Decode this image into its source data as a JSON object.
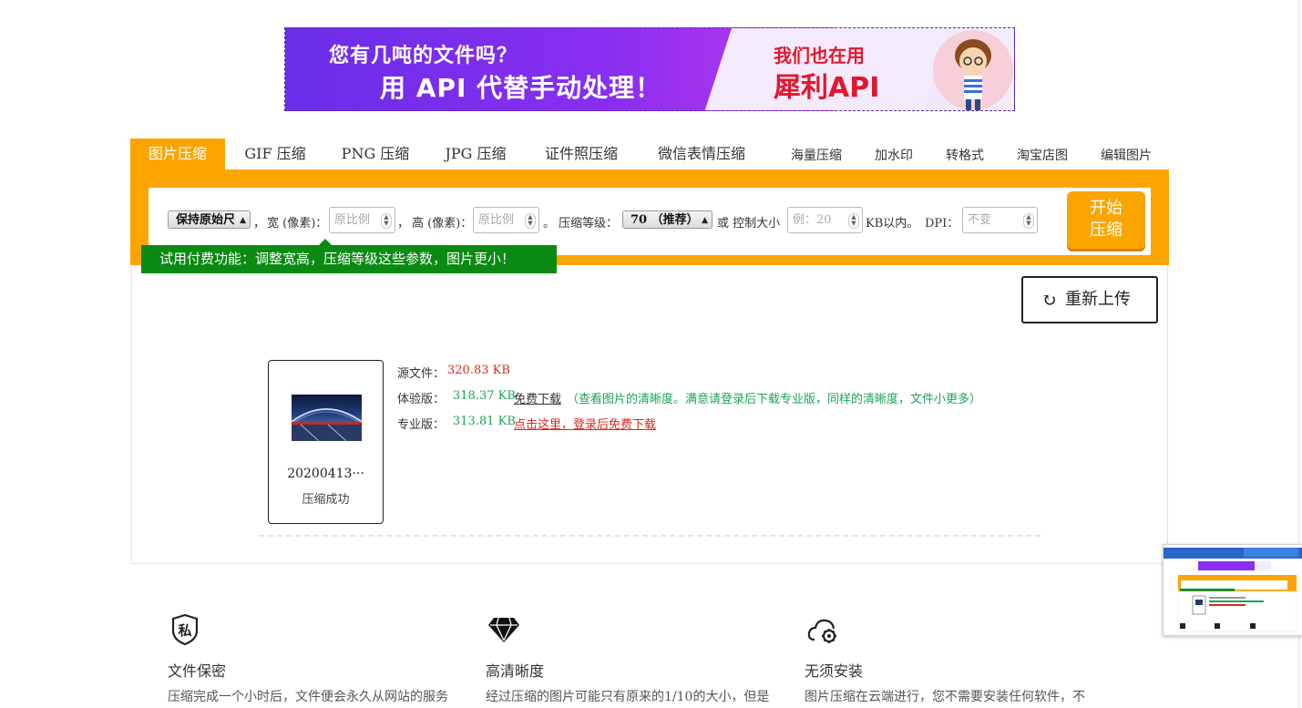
{
  "banner": {
    "line1": "您有几吨的文件吗？",
    "line2": "用 API 代替手动处理！",
    "right1": "我们也在用",
    "right2": "犀利API"
  },
  "tabs": [
    {
      "label": "图片压缩",
      "active": true
    },
    {
      "label": "GIF 压缩"
    },
    {
      "label": "PNG 压缩"
    },
    {
      "label": "JPG 压缩"
    },
    {
      "label": "证件照压缩"
    },
    {
      "label": "微信表情压缩"
    },
    {
      "label": "海量压缩"
    },
    {
      "label": "加水印"
    },
    {
      "label": "转格式"
    },
    {
      "label": "淘宝店图"
    },
    {
      "label": "编辑图片"
    }
  ],
  "options": {
    "size_mode": "保持原始尺寸",
    "width_label": "宽 (像素)：",
    "width_placeholder": "原比例",
    "height_label": "高 (像素)：",
    "height_placeholder": "原比例",
    "level_label": "压缩等级：",
    "level_value": "70 （推荐）",
    "or_label": "或 控制大小",
    "size_placeholder": "例：20",
    "kb_label": "KB以内。",
    "dpi_label": "DPI：",
    "dpi_placeholder": "不变",
    "start_label_1": "开始",
    "start_label_2": "压缩"
  },
  "promo": "试用付费功能：调整宽高，压缩等级这些参数，图片更小！",
  "reupload_label": "重新上传",
  "result": {
    "filename": "20200413···",
    "status": "压缩成功",
    "source_label": "源文件：",
    "source_size": "320.83 KB",
    "trial_label": "体验版：",
    "trial_size": "318.37 KB",
    "trial_link": "免费下载",
    "trial_note": "（查看图片的清晰度。满意请登录后下载专业版，同样的清晰度，文件小更多）",
    "pro_label": "专业版：",
    "pro_size": "313.81 KB",
    "pro_link": "点击这里，登录后免费下载"
  },
  "features": [
    {
      "icon": "privacy-icon",
      "icon_char": "私",
      "title": "文件保密",
      "desc": "压缩完成一个小时后，文件便会永久从网站的服务"
    },
    {
      "icon": "diamond-icon",
      "title": "高清晰度",
      "desc": "经过压缩的图片可能只有原来的1/10的大小，但是"
    },
    {
      "icon": "cloud-gear-icon",
      "title": "无须安装",
      "desc": "图片压缩在云端进行，您不需要安装任何软件，不"
    }
  ],
  "colors": {
    "accent": "#fca500",
    "promo_green": "#0a8a12",
    "size_red": "#e0261b",
    "size_green": "#1aa35a"
  }
}
